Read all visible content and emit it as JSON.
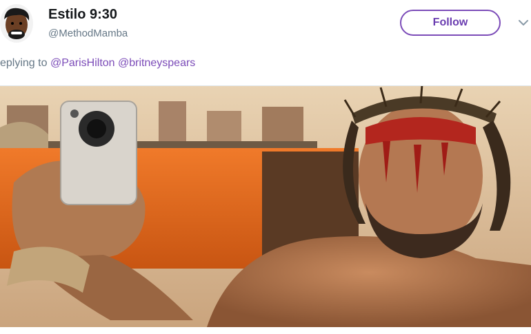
{
  "tweet": {
    "display_name": "Estilo 9:30",
    "handle": "@MethodMamba",
    "follow_label": "Follow",
    "reply_prefix": "eplying to",
    "mentions": [
      "@ParisHilton",
      "@britneyspears"
    ]
  },
  "icons": {
    "avatar": "avatar-illustration",
    "menu": "chevron-down-icon"
  },
  "colors": {
    "accent": "#7b4bb8",
    "secondary_text": "#657786",
    "primary_text": "#14171a"
  }
}
